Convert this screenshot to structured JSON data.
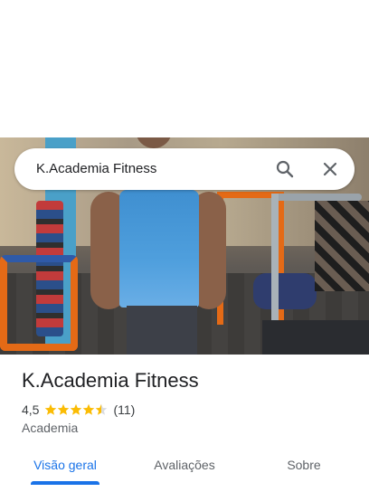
{
  "search": {
    "query": "K.Academia Fitness"
  },
  "place": {
    "name": "K.Academia Fitness",
    "rating": "4,5",
    "stars_filled": 4.5,
    "review_count": "(11)",
    "category": "Academia"
  },
  "tabs": [
    {
      "label": "Visão geral",
      "active": true
    },
    {
      "label": "Avaliações",
      "active": false
    },
    {
      "label": "Sobre",
      "active": false
    }
  ],
  "colors": {
    "accent": "#1a73e8",
    "star": "#fbbc04"
  },
  "icons": {
    "search": "search-icon",
    "close": "close-icon"
  }
}
